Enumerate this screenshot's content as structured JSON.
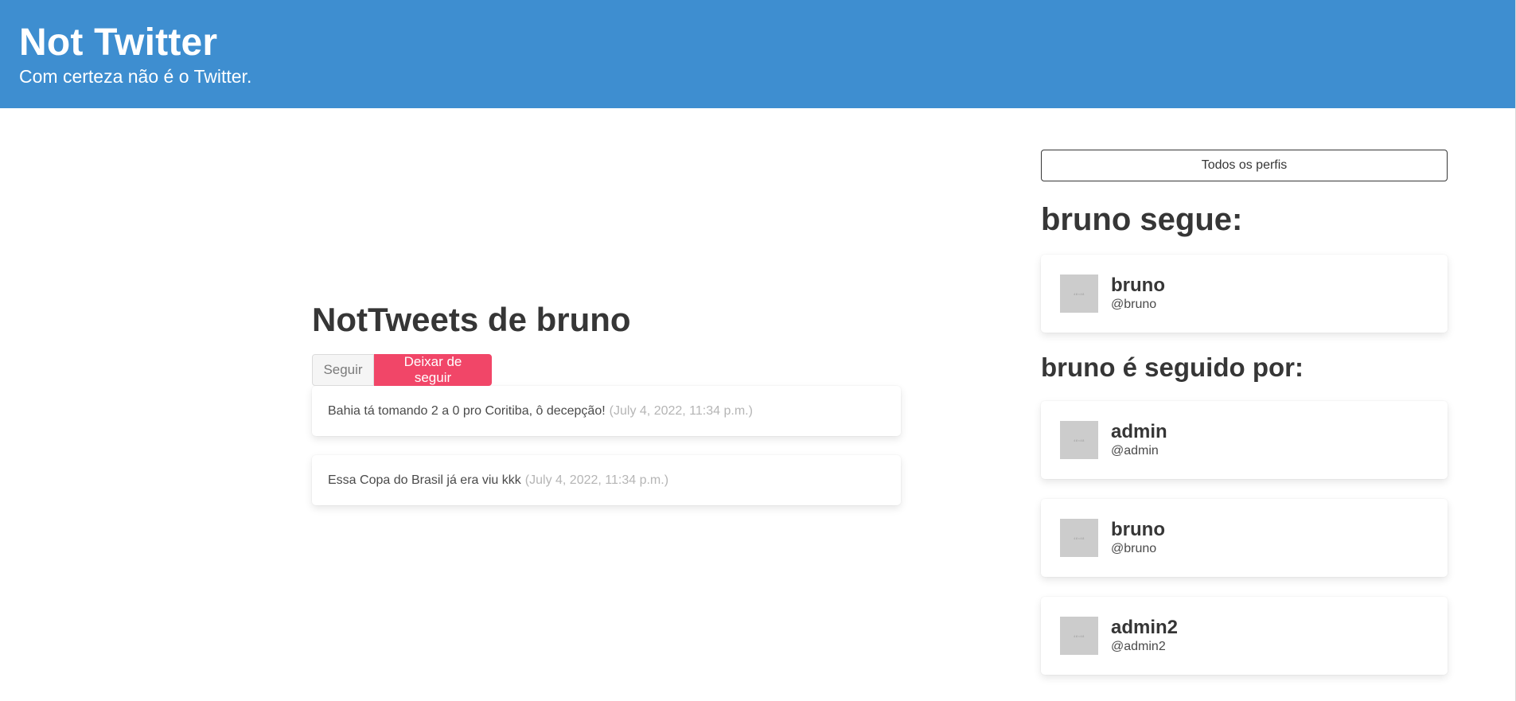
{
  "header": {
    "title": "Not Twitter",
    "subtitle": "Com certeza não é o Twitter."
  },
  "main": {
    "title": "NotTweets de bruno",
    "follow_label": "Seguir",
    "unfollow_label": "Deixar de seguir",
    "tweets": [
      {
        "text": "Bahia tá tomando 2 a 0 pro Coritiba, ô decepção!",
        "date": "(July 4, 2022, 11:34 p.m.)"
      },
      {
        "text": "Essa Copa do Brasil já era viu kkk",
        "date": "(July 4, 2022, 11:34 p.m.)"
      }
    ]
  },
  "sidebar": {
    "all_profiles_label": "Todos os perfis",
    "follows_title": "bruno segue:",
    "follows": [
      {
        "name": "bruno",
        "handle": "@bruno"
      }
    ],
    "followers_title": "bruno é seguido por:",
    "followers": [
      {
        "name": "admin",
        "handle": "@admin"
      },
      {
        "name": "bruno",
        "handle": "@bruno"
      },
      {
        "name": "admin2",
        "handle": "@admin2"
      }
    ],
    "avatar_placeholder": "48×48"
  },
  "colors": {
    "hero": "#3e8ed0",
    "danger": "#f14668",
    "avatar": "#cccccc"
  }
}
